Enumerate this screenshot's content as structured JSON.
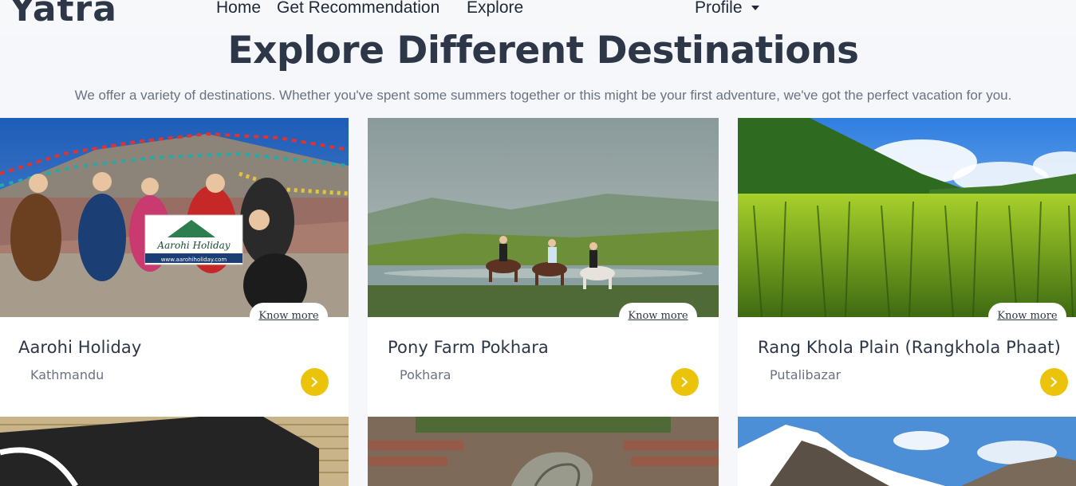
{
  "nav": {
    "brand": "Yatra",
    "home": "Home",
    "recommendation": "Get Recommendation",
    "explore": "Explore",
    "profile": "Profile"
  },
  "hero": {
    "title": "Explore Different Destinations",
    "subtitle": "We offer a variety of destinations. Whether you've spent some summers together or this might be your first adventure, we've got the perfect vacation for you."
  },
  "cards": [
    {
      "title": "Aarohi Holiday",
      "location": "Kathmandu",
      "know_more": "Know more",
      "icon": "chevron-right-icon"
    },
    {
      "title": "Pony Farm Pokhara",
      "location": "Pokhara",
      "know_more": "Know more",
      "icon": "chevron-right-icon"
    },
    {
      "title": "Rang Khola Plain (Rangkhola Phaat)",
      "location": "Putalibazar",
      "know_more": "Know more",
      "icon": "chevron-right-icon"
    }
  ],
  "colors": {
    "accent": "#ecc30b",
    "heading": "#2d3748",
    "muted": "#6b7280",
    "background": "#f5f7fa"
  }
}
